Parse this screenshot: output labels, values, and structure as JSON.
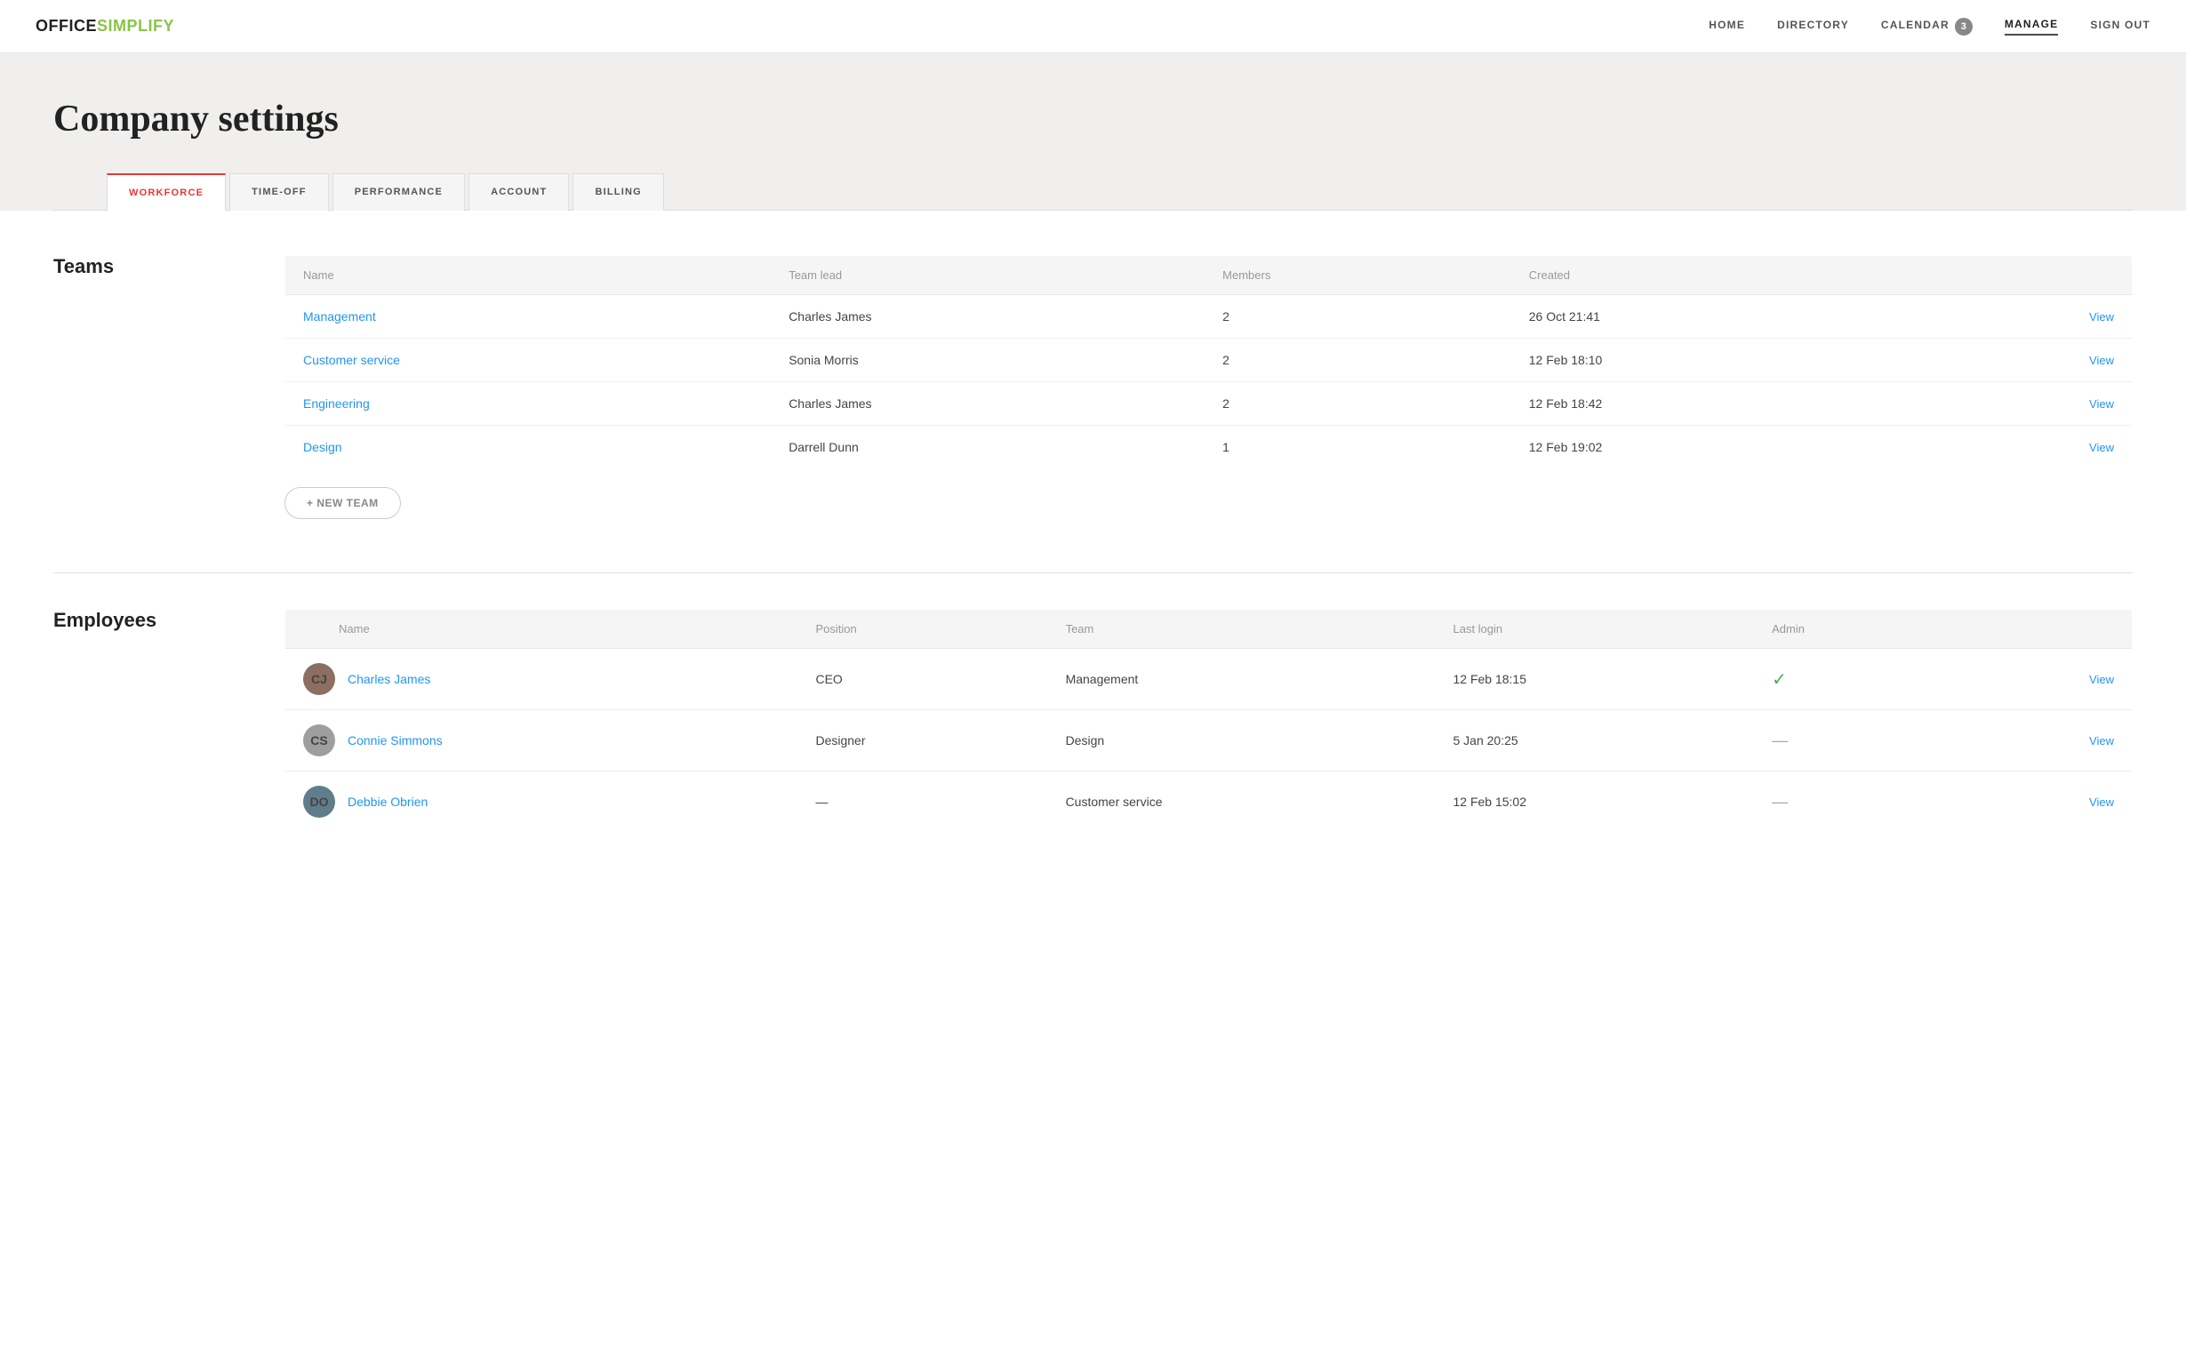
{
  "nav": {
    "logo_office": "OFFICE",
    "logo_simplify": "SIMPLIFY",
    "links": [
      {
        "label": "HOME",
        "active": false
      },
      {
        "label": "DIRECTORY",
        "active": false
      },
      {
        "label": "CALENDAR",
        "active": false,
        "badge": "3"
      },
      {
        "label": "MANAGE",
        "active": true
      },
      {
        "label": "SIGN OUT",
        "active": false
      }
    ]
  },
  "page": {
    "title": "Company settings"
  },
  "tabs": [
    {
      "label": "WORKFORCE",
      "active": true
    },
    {
      "label": "TIME-OFF",
      "active": false
    },
    {
      "label": "PERFORMANCE",
      "active": false
    },
    {
      "label": "ACCOUNT",
      "active": false
    },
    {
      "label": "BILLING",
      "active": false
    }
  ],
  "teams": {
    "section_title": "Teams",
    "columns": [
      "Name",
      "Team lead",
      "Members",
      "Created"
    ],
    "rows": [
      {
        "name": "Management",
        "lead": "Charles James",
        "members": "2",
        "created": "26 Oct 21:41"
      },
      {
        "name": "Customer service",
        "lead": "Sonia Morris",
        "members": "2",
        "created": "12 Feb 18:10"
      },
      {
        "name": "Engineering",
        "lead": "Charles James",
        "members": "2",
        "created": "12 Feb 18:42"
      },
      {
        "name": "Design",
        "lead": "Darrell Dunn",
        "members": "1",
        "created": "12 Feb 19:02"
      }
    ],
    "new_team_label": "+ NEW TEAM"
  },
  "employees": {
    "section_title": "Employees",
    "columns": [
      "Name",
      "Position",
      "Team",
      "Last login",
      "Admin"
    ],
    "rows": [
      {
        "name": "Charles James",
        "position": "CEO",
        "team": "Management",
        "last_login": "12 Feb 18:15",
        "admin": true,
        "initials": "CJ",
        "avatar_class": "avatar-cj"
      },
      {
        "name": "Connie Simmons",
        "position": "Designer",
        "team": "Design",
        "last_login": "5 Jan 20:25",
        "admin": false,
        "initials": "CS",
        "avatar_class": "avatar-cs"
      },
      {
        "name": "Debbie Obrien",
        "position": "—",
        "team": "Customer service",
        "last_login": "12 Feb 15:02",
        "admin": false,
        "initials": "DO",
        "avatar_class": "avatar-do"
      }
    ]
  }
}
